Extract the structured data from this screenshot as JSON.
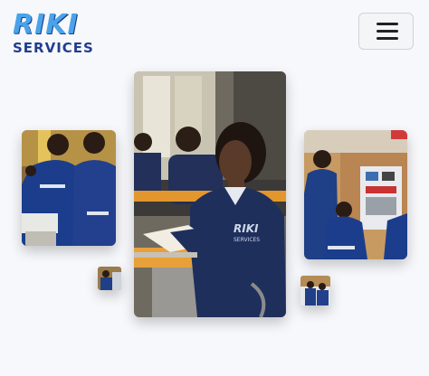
{
  "brand": {
    "logo_text": "RIKI",
    "logo_subtext": "SERVICES"
  },
  "header": {
    "menu_button_icon": "hamburger-menu-icon"
  },
  "gallery": {
    "images": [
      {
        "name": "classroom-student-photo",
        "depicts": "student in navy uniform with notebook in classroom"
      },
      {
        "name": "trainees-workshop-photo",
        "depicts": "trainees in blue coveralls at workbench"
      },
      {
        "name": "electrical-panel-training-photo",
        "depicts": "trainees at electrical control panel"
      },
      {
        "name": "small-thumbnail-left",
        "depicts": "workshop thumbnail"
      },
      {
        "name": "small-thumbnail-right",
        "depicts": "workshop thumbnail"
      }
    ]
  },
  "colors": {
    "background": "#f7f8fb",
    "logo_blue": "#4aa3e8",
    "logo_navy": "#223d8f",
    "uniform_navy": "#1f2f5c"
  }
}
